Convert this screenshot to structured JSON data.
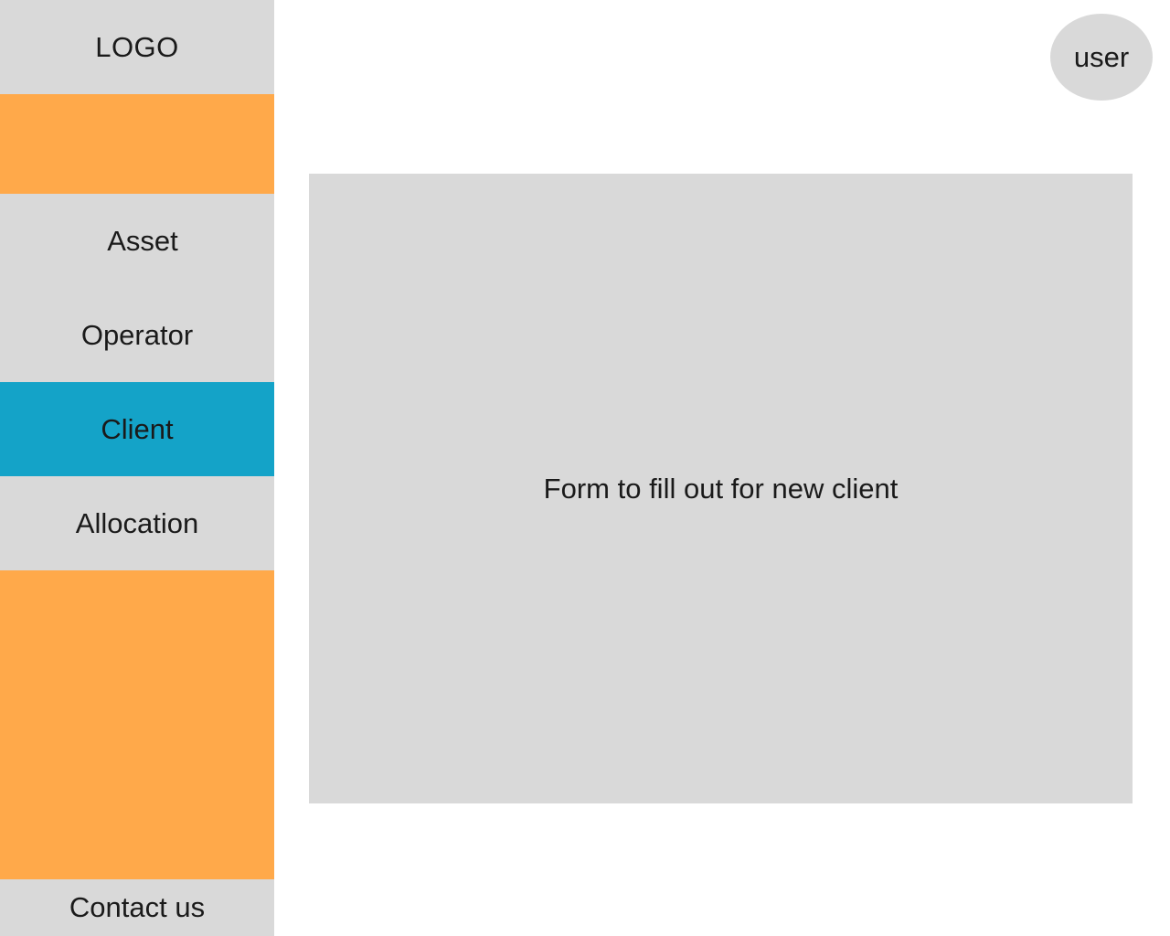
{
  "colors": {
    "sidebar_bg": "#d9d9d9",
    "accent": "#ffa94a",
    "active": "#14a3c8",
    "panel_bg": "#d9d9d9"
  },
  "sidebar": {
    "logo": "LOGO",
    "items": [
      {
        "label": "Asset",
        "active": false
      },
      {
        "label": "Operator",
        "active": false
      },
      {
        "label": "Client",
        "active": true
      },
      {
        "label": "Allocation",
        "active": false
      }
    ],
    "contact": "Contact us"
  },
  "header": {
    "user_label": "user"
  },
  "main": {
    "form_placeholder": "Form to fill out for new client"
  }
}
